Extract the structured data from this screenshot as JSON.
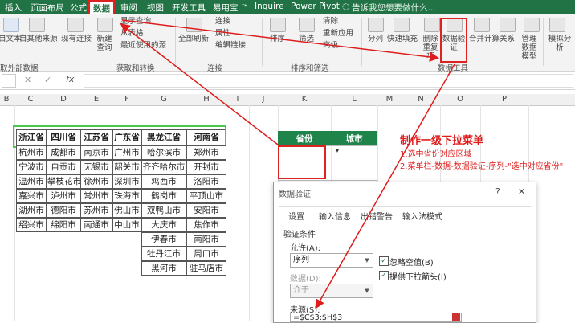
{
  "tabs": {
    "insert": "插入",
    "page_layout": "页面布局",
    "formulas": "公式",
    "data": "数据",
    "review": "审阅",
    "view": "视图",
    "developer": "开发工具",
    "yiyongbao": "易用宝 ™",
    "inquire": "Inquire",
    "power_pivot": "Power Pivot",
    "tell_me": "告诉我您想要做什么..."
  },
  "ribbon": {
    "from_text": "自文本",
    "from_other": "自其他来源",
    "existing_conn": "现有连接",
    "new_query": "新建查询",
    "show_queries": "显示查询",
    "from_table": "从表格",
    "recent_sources": "最近使用的源",
    "refresh_all": "全部刷新",
    "connections": "连接",
    "properties": "属性",
    "edit_links": "编辑链接",
    "sort": "排序",
    "filter": "筛选",
    "clear": "清除",
    "reapply": "重新应用",
    "advanced": "高级",
    "split": "分列",
    "flash_fill": "快速填充",
    "remove_dup": "删除重复项",
    "data_validation": "数据验证",
    "consolidate": "合并计算",
    "relationships": "关系",
    "manage_model": "管理数据模型",
    "what_if": "模拟分析",
    "group_get_external": "取外部数据",
    "group_get_transform": "获取和转换",
    "group_connections": "连接",
    "group_sort_filter": "排序和筛选",
    "group_data_tools": "数据工具"
  },
  "formula_bar": {
    "name_box": "",
    "fx": "fx",
    "cancel": "✕",
    "enter": "✓",
    "value": ""
  },
  "columns": [
    "B",
    "C",
    "D",
    "E",
    "F",
    "G",
    "H",
    "I",
    "J",
    "K",
    "L",
    "M",
    "N",
    "O",
    "P"
  ],
  "table": {
    "headers": [
      "浙江省",
      "四川省",
      "江苏省",
      "广东省",
      "黑龙江省",
      "河南省"
    ],
    "rows": [
      [
        "杭州市",
        "成都市",
        "南京市",
        "广州市",
        "哈尔滨市",
        "郑州市"
      ],
      [
        "宁波市",
        "自贡市",
        "无锡市",
        "韶关市",
        "齐齐哈尔市",
        "开封市"
      ],
      [
        "温州市",
        "攀枝花市",
        "徐州市",
        "深圳市",
        "鸡西市",
        "洛阳市"
      ],
      [
        "嘉兴市",
        "泸州市",
        "常州市",
        "珠海市",
        "鹤岗市",
        "平顶山市"
      ],
      [
        "湖州市",
        "德阳市",
        "苏州市",
        "佛山市",
        "双鸭山市",
        "安阳市"
      ],
      [
        "绍兴市",
        "绵阳市",
        "南通市",
        "中山市",
        "大庆市",
        "焦作市"
      ],
      [
        "",
        "",
        "",
        "",
        "伊春市",
        "南阳市"
      ],
      [
        "",
        "",
        "",
        "",
        "牡丹江市",
        "周口市"
      ],
      [
        "",
        "",
        "",
        "",
        "黑河市",
        "驻马店市"
      ]
    ]
  },
  "target": {
    "province_header": "省份",
    "city_header": "城市"
  },
  "annotation": {
    "title": "制作一级下拉菜单",
    "step1": "1.选中省份对应区域",
    "step2": "2.菜单栏-数据-数据验证-序列-\"选中对应省份\""
  },
  "dialog": {
    "title": "数据验证",
    "help": "?",
    "close": "✕",
    "tabs": [
      "设置",
      "输入信息",
      "出错警告",
      "输入法模式"
    ],
    "section": "验证条件",
    "allow_label": "允许(A):",
    "allow_value": "序列",
    "ignore_blank": "忽略空值(B)",
    "ignore_blank_checked": true,
    "dropdown_arrow": "提供下拉箭头(I)",
    "dropdown_arrow_checked": true,
    "data_label": "数据(D):",
    "data_value": "介于",
    "source_label": "来源(S):",
    "source_value": "=$C$3:$H$3"
  },
  "colors": {
    "excel_green": "#217346",
    "annotation_red": "#e01b1b",
    "header_fill": "#1e8449",
    "highlight_border": "#4bc74b"
  }
}
